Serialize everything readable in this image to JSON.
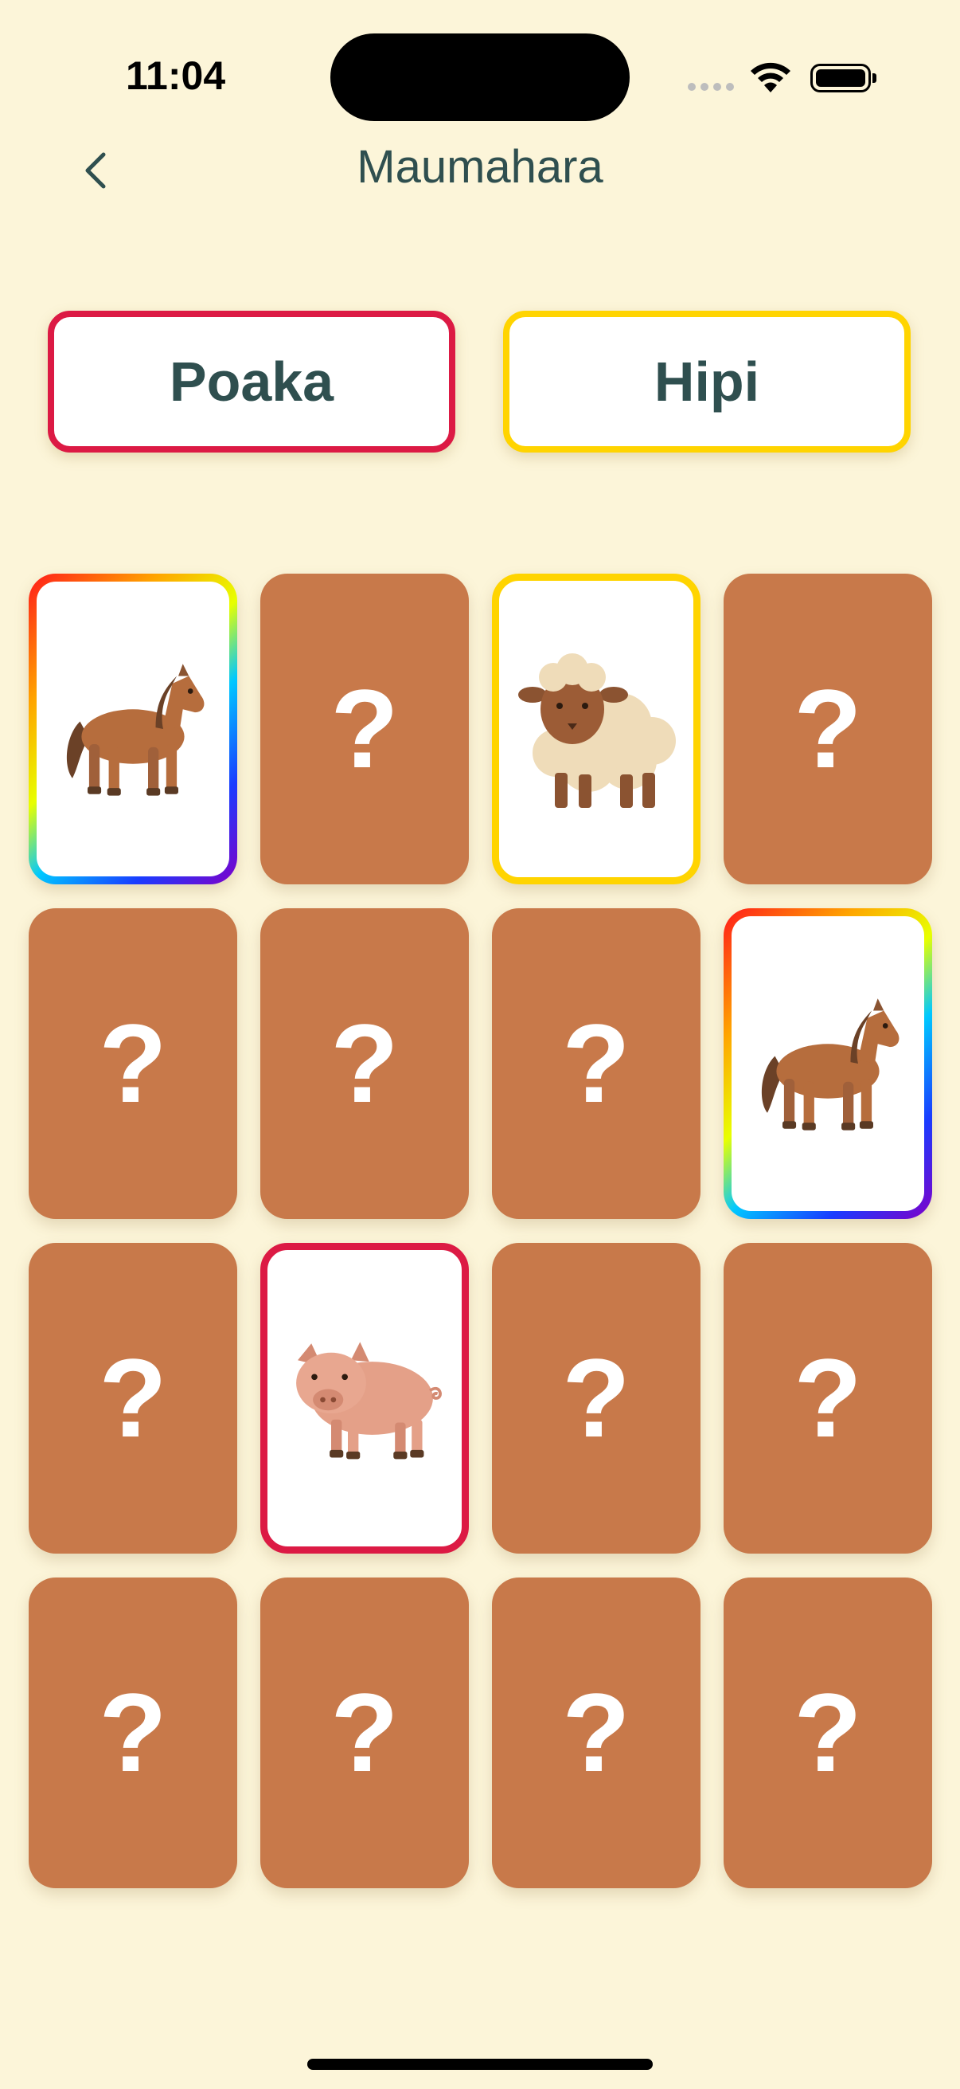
{
  "status": {
    "time": "11:04"
  },
  "nav": {
    "title": "Maumahara"
  },
  "chips": [
    {
      "label": "Poaka",
      "color": "#dc1a44"
    },
    {
      "label": "Hipi",
      "color": "#ffd400"
    }
  ],
  "card_back_symbol": "?",
  "colors": {
    "background": "#fcf5d9",
    "card_back": "#c8794a",
    "text": "#2f4f4f"
  },
  "cards": [
    {
      "state": "face-up",
      "icon": "horse-icon",
      "border": "rainbow"
    },
    {
      "state": "face-down"
    },
    {
      "state": "face-up",
      "icon": "sheep-icon",
      "border": "#ffd400"
    },
    {
      "state": "face-down"
    },
    {
      "state": "face-down"
    },
    {
      "state": "face-down"
    },
    {
      "state": "face-down"
    },
    {
      "state": "face-up",
      "icon": "horse-icon",
      "border": "rainbow"
    },
    {
      "state": "face-down"
    },
    {
      "state": "face-up",
      "icon": "pig-icon",
      "border": "#dc1a44"
    },
    {
      "state": "face-down"
    },
    {
      "state": "face-down"
    },
    {
      "state": "face-down"
    },
    {
      "state": "face-down"
    },
    {
      "state": "face-down"
    },
    {
      "state": "face-down"
    }
  ]
}
